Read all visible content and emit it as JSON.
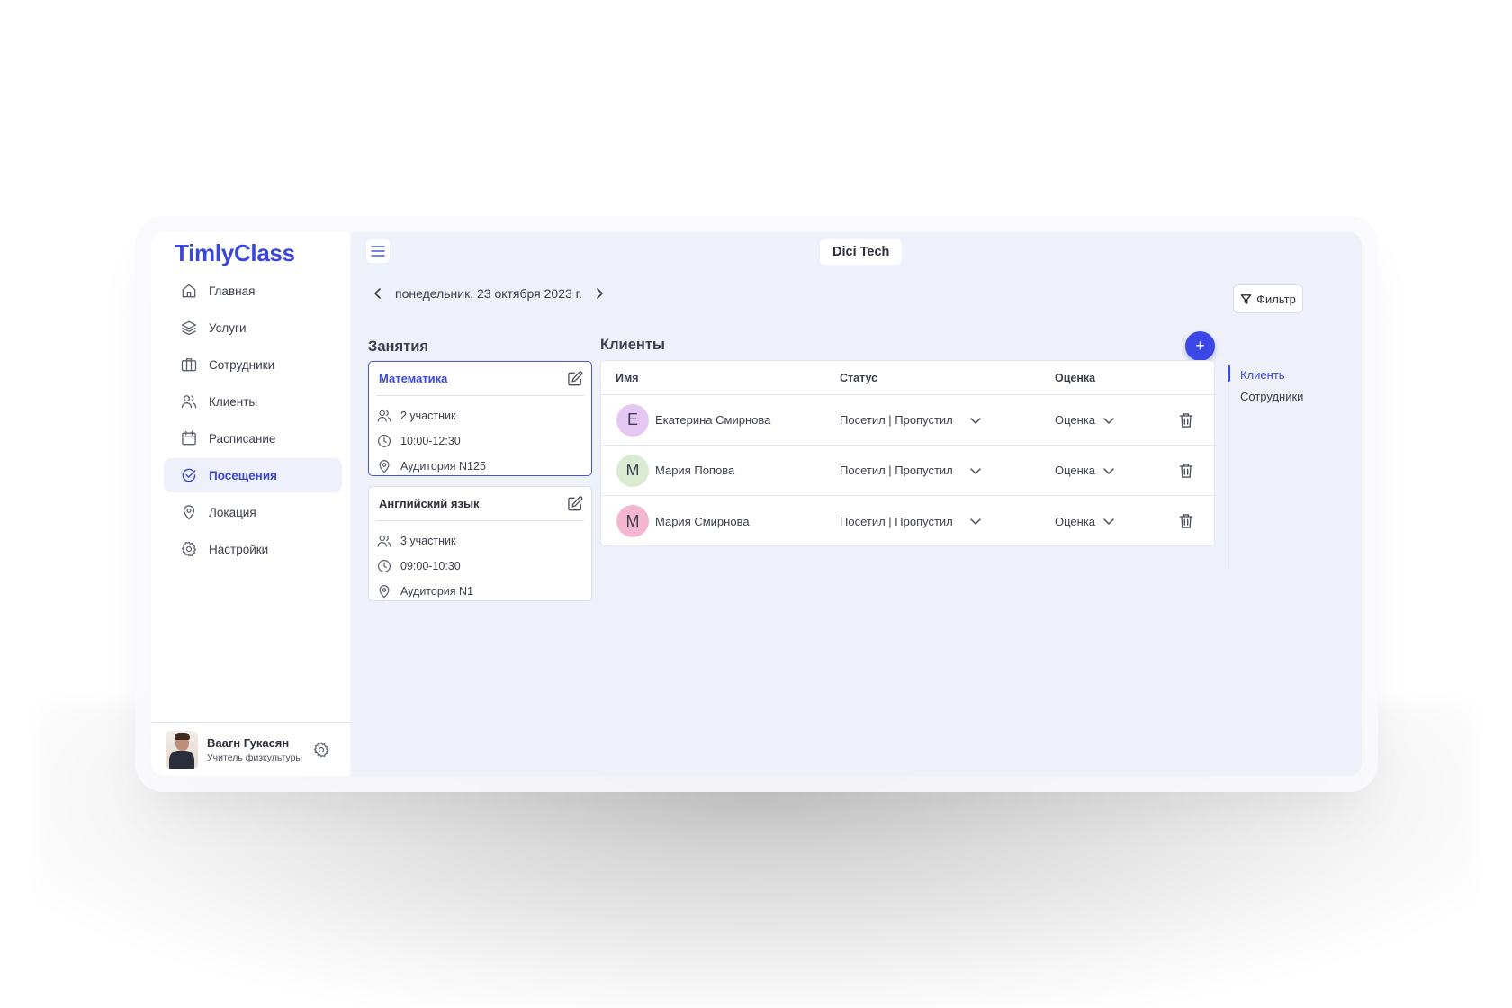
{
  "app": {
    "logo": "TimlyClass",
    "org_name": "Dici Tech"
  },
  "colors": {
    "accent": "#3b47d6",
    "add_button": "#3b47e6",
    "background": "#eef1f9"
  },
  "sidebar": {
    "items": [
      {
        "label": "Главная",
        "icon": "home-icon"
      },
      {
        "label": "Услуги",
        "icon": "layers-icon"
      },
      {
        "label": "Сотрудники",
        "icon": "briefcase-icon"
      },
      {
        "label": "Клиенты",
        "icon": "users-icon"
      },
      {
        "label": "Расписание",
        "icon": "calendar-icon"
      },
      {
        "label": "Посещения",
        "icon": "check-circle-icon",
        "active": true
      },
      {
        "label": "Локация",
        "icon": "map-pin-icon"
      },
      {
        "label": "Настройки",
        "icon": "gear-icon"
      }
    ],
    "profile": {
      "name": "Ваагн Гукасян",
      "role": "Учитель физкультуры"
    }
  },
  "header": {
    "date": "понедельник, 23 октября 2023 г.",
    "filter_label": "Фильтр"
  },
  "lessons": {
    "title": "Занятия",
    "items": [
      {
        "title": "Математика",
        "participants": "2 участник",
        "time": "10:00-12:30",
        "room": "Аудитория N125",
        "active": true
      },
      {
        "title": "Английский язык",
        "participants": "3 участник",
        "time": "09:00-10:30",
        "room": "Аудитория N1"
      }
    ]
  },
  "clients": {
    "title": "Клиенты",
    "add_label": "+",
    "columns": {
      "name": "Имя",
      "status": "Статус",
      "grade": "Оценка"
    },
    "rows": [
      {
        "initial": "Е",
        "name": "Екатерина Смирнова",
        "status": "Посетил | Пропустил",
        "grade": "Оценка",
        "avatar_color": "#e6c6f2"
      },
      {
        "initial": "М",
        "name": "Мария Попова",
        "status": "Посетил | Пропустил",
        "grade": "Оценка",
        "avatar_color": "#d9ecd2"
      },
      {
        "initial": "М",
        "name": "Мария Смирнова",
        "status": "Посетил | Пропустил",
        "grade": "Оценка",
        "avatar_color": "#f5b7cf"
      }
    ]
  },
  "side_tabs": {
    "items": [
      "Клиенть",
      "Сотрудники"
    ],
    "active": "Клиенть"
  }
}
